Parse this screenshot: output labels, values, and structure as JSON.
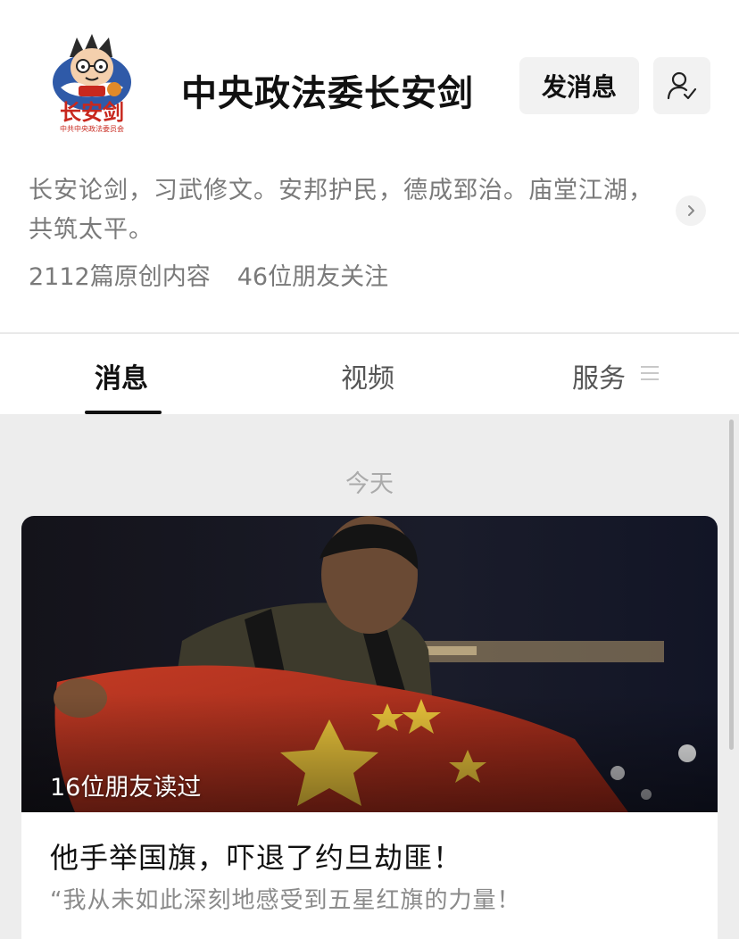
{
  "account": {
    "name": "中央政法委长安剑",
    "logo_text": "长安剑",
    "logo_subtext": "中共中央政法委员会",
    "message_button": "发消息",
    "follow_icon": "person-check-icon",
    "description": "长安论剑，习武修文。安邦护民，德成郅治。庙堂江湖，共筑太平。",
    "original_count": "2112篇原创内容",
    "friends_following": "46位朋友关注"
  },
  "tabs": [
    {
      "label": "消息",
      "active": true
    },
    {
      "label": "视频",
      "active": false
    },
    {
      "label": "服务",
      "active": false
    }
  ],
  "feed": {
    "date_label": "今天",
    "article": {
      "read_by": "16位朋友读过",
      "title": "他手举国旗，吓退了约旦劫匪！",
      "digest": "“我从未如此深刻地感受到五星红旗的力量！"
    }
  },
  "colors": {
    "flag_red": "#b8321f",
    "star_yellow": "#e8c23a",
    "logo_red": "#c8281e",
    "logo_blue": "#2f5aa8"
  }
}
